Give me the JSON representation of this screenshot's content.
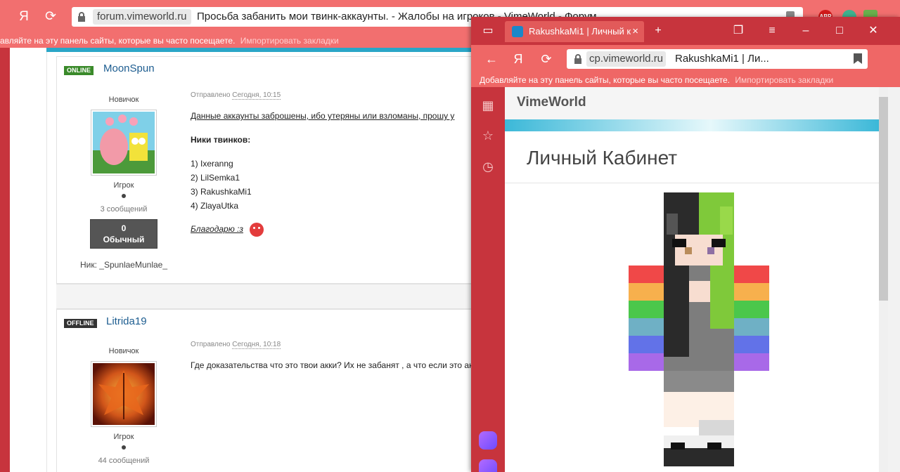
{
  "bg_browser": {
    "yandex_label": "Я",
    "url_domain": "forum.vimeworld.ru",
    "url_title": "Просьба забанить мои твинк-аккаунты. - Жалобы на игроков - VimeWorld - Форум",
    "ext_abp": "ABP",
    "bookmarks_text": "авляйте на эту панель сайты, которые вы часто посещаете.",
    "bookmarks_import": "Импортировать закладки"
  },
  "posts": [
    {
      "status": "ONLINE",
      "author": "MoonSpun",
      "rank": "Новичок",
      "group": "Игрок",
      "count": "3 сообщений",
      "rep_value": "0",
      "rep_label": "Обычный",
      "nick": "Ник: _SpunlaeMunlae_",
      "posted_label": "Отправлено",
      "posted_date": "Сегодня, 10:15",
      "text_line": "Данные аккаунты заброшены, ибо утеряны или взломаны, прошу у",
      "twinks_title": "Ники твинков:",
      "twinks": [
        "1) Ixeranng",
        "2) LilSemka1",
        "3) RakushkaMi1",
        "4) ZlayaUtka"
      ],
      "thanks": "Благодарю :з"
    },
    {
      "status": "OFFLINE",
      "author": "Litrida19",
      "rank": "Новичок",
      "group": "Игрок",
      "count": "44 сообщений",
      "posted_label": "Отправлено",
      "posted_date": "Сегодня, 10:18",
      "text_line": "Где доказательства что это твои акки? Их не забанят , а что если это ак"
    }
  ],
  "fg_browser": {
    "tab_title": "RakushkaMi1 | Личный к",
    "yandex_label": "Я",
    "url_domain": "cp.vimeworld.ru",
    "url_title": "RakushkaMi1 | Ли...",
    "bookmarks_text": "Добавляйте на эту панель сайты, которые вы часто посещаете.",
    "bookmarks_import": "Импортировать закладки",
    "brand": "VimeWorld",
    "heading": "Личный Кабинет"
  },
  "colors": {
    "toolbar_red": "#ef6766",
    "title_red": "#c7343d",
    "link_blue": "#1d5d90",
    "online_green": "#3a8a2a"
  }
}
